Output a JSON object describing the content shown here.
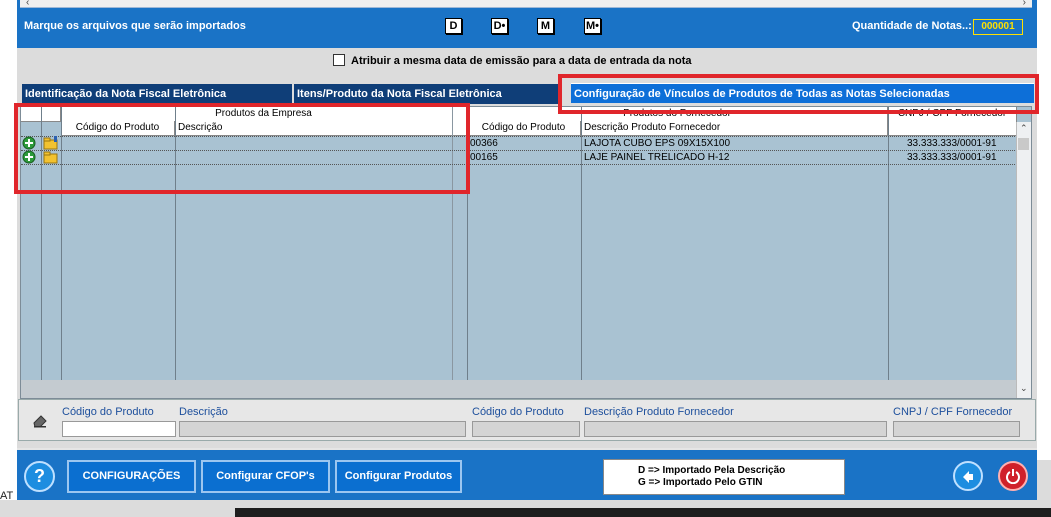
{
  "top": {
    "mark_label": "Marque os arquivos que serão importados",
    "key_buttons": [
      "D",
      "D•",
      "M",
      "M•"
    ],
    "qty_label": "Quantidade de Notas..:",
    "qty_value": "000001"
  },
  "checkbox": {
    "label": "Atribuir a mesma data de emissão para a data de entrada da nota",
    "checked": false
  },
  "tabs": [
    {
      "label": "Identificação da Nota Fiscal Eletrônica",
      "active": false
    },
    {
      "label": "Itens/Produto da Nota Fiscal Eletrônica",
      "active": false
    },
    {
      "label": "Configuração de Vínculos de Produtos de Todas as Notas Selecionadas",
      "active": true
    }
  ],
  "grid": {
    "group_empresa": "Produtos da Empresa",
    "group_fornecedor": "Produtos do Fornecedor",
    "col_cnpj": "CNPJ / CPF Fornecedor",
    "col_codigo_empresa": "Código do Produto",
    "col_descricao_empresa": "Descrição",
    "col_codigo_fornecedor": "Código do Produto",
    "col_descricao_fornecedor": "Descrição Produto Fornecedor",
    "rows": [
      {
        "codigo_empresa": "",
        "descricao_empresa": "",
        "codigo_fornecedor": "00366",
        "descricao_fornecedor": "LAJOTA CUBO EPS 09X15X100",
        "cnpj": "33.333.333/0001-91"
      },
      {
        "codigo_empresa": "",
        "descricao_empresa": "",
        "codigo_fornecedor": "00165",
        "descricao_fornecedor": "LAJE PAINEL TRELICADO H-12",
        "cnpj": "33.333.333/0001-91"
      }
    ]
  },
  "edit": {
    "codigo_produto": "Código do Produto",
    "descricao": "Descrição",
    "codigo_produto_fornecedor": "Código do Produto",
    "descricao_fornecedor": "Descrição Produto Fornecedor",
    "cnpj": "CNPJ / CPF Fornecedor"
  },
  "footer": {
    "help": "?",
    "configuracoes": "CONFIGURAÇÕES",
    "configurar_cfop": "Configurar CFOP's",
    "configurar_produtos": "Configurar Produtos",
    "legend_d": "D => Importado Pela Descrição",
    "legend_g": "G => Importado Pelo GTIN"
  },
  "status": "AT",
  "colors": {
    "header_blue": "#1a73c6",
    "tab_dark": "#0f3e78",
    "tab_active": "#0d6fd8",
    "grid_bg": "#a9c2d2",
    "highlight_red": "#e0262b",
    "qty_yellow": "#ffe000"
  }
}
